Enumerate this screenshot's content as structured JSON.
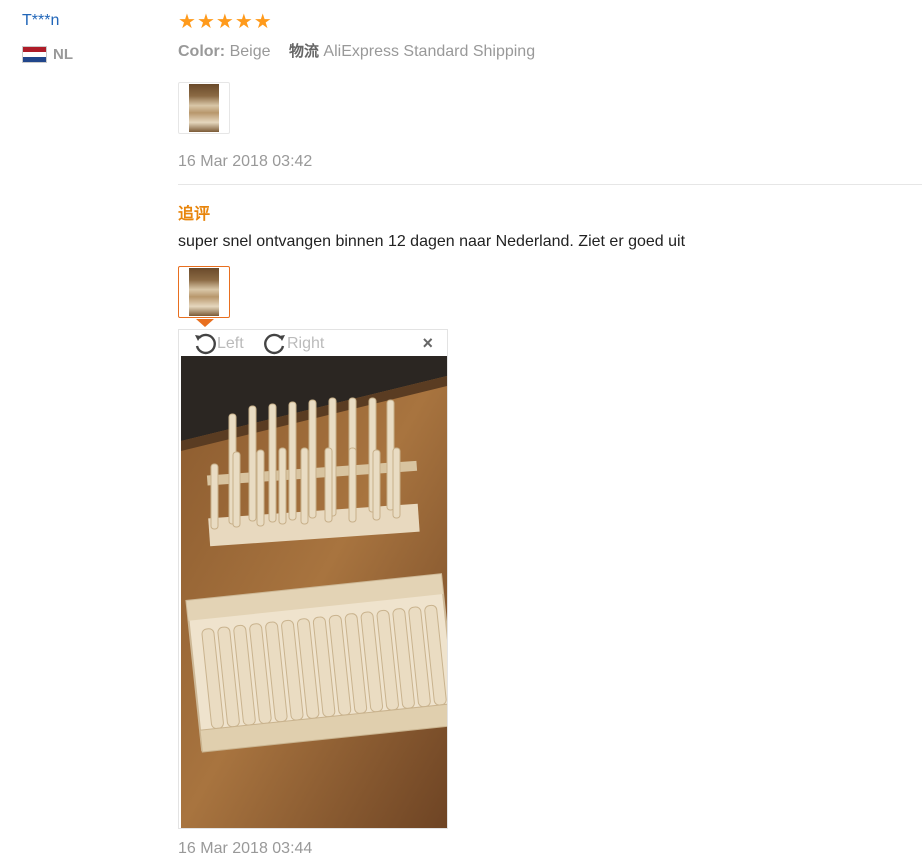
{
  "reviewer": {
    "name": "T***n",
    "country": "NL"
  },
  "review": {
    "rating": 5,
    "color_label": "Color:",
    "color_value": "Beige",
    "shipping_label": "物流",
    "shipping_value": "AliExpress Standard Shipping",
    "date": "16 Mar 2018 03:42"
  },
  "followup": {
    "label": "追评",
    "text": "super snel ontvangen binnen 12 dagen naar Nederland. Ziet er goed uit",
    "date": "16 Mar 2018 03:44"
  },
  "viewer": {
    "rotate_left": "Left",
    "rotate_right": "Right",
    "close": "×"
  },
  "icons": {
    "star": "star-icon",
    "flag": "netherlands-flag-icon",
    "rotate_left": "rotate-left-icon",
    "rotate_right": "rotate-right-icon",
    "close": "close-icon"
  },
  "colors": {
    "name": "#2166b9",
    "star": "#ff9a1b",
    "followup": "#e8850c",
    "thumb_active": "#e86f1f"
  }
}
